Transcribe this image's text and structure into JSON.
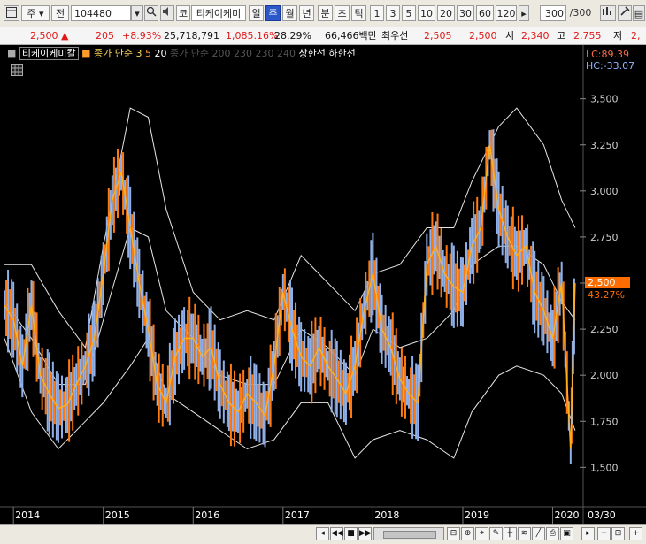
{
  "toolbar": {
    "market": "주",
    "market_dd": "전",
    "code": "104480",
    "tab_code_label": "코",
    "stock_name": "티케이케미",
    "periods": [
      "일",
      "주",
      "월",
      "년",
      "분",
      "초",
      "틱"
    ],
    "active_period": "주",
    "intervals": [
      "1",
      "3",
      "5",
      "10",
      "20",
      "30",
      "60",
      "120"
    ],
    "count": "300",
    "count_total": "/300"
  },
  "quote": {
    "price": "2,500",
    "change_arrow": "▲",
    "change": "205",
    "change_pct": "+8.93%",
    "volume": "25,718,791",
    "vol_ratio": "1,085.16%",
    "turnover": "28.29%",
    "amount": "66,466백만",
    "prior_label": "최우선",
    "ask": "2,505",
    "bid": "2,500",
    "open_label": "시",
    "open": "2,340",
    "high_label": "고",
    "high": "2,755",
    "low_label": "저",
    "low_partial": "2,"
  },
  "legend": {
    "name": "티케이케미칼",
    "ma_label": "종가 단순",
    "ma_periods": [
      "3",
      "5",
      "20"
    ],
    "ma_long": "종가 단순 200 230 230 240",
    "upper_limit": "상한선",
    "lower_limit": "하한선",
    "lc": "LC:89.39",
    "hc": "HC:-33.07"
  },
  "current_price_tag": "2,500",
  "current_pct_tag": "43.27%",
  "end_label": "03/30",
  "chart_data": {
    "type": "line",
    "title": "티케이케미칼",
    "y_ticks": [
      "3,500",
      "3,250",
      "3,000",
      "2,750",
      "2,500",
      "2,250",
      "2,000",
      "1,750",
      "1,500"
    ],
    "ylim": [
      1300,
      3700
    ],
    "x_labels": [
      "2014",
      "2015",
      "2016",
      "2017",
      "2018",
      "2019",
      "2020"
    ],
    "series": [
      {
        "name": "종가",
        "color": "#ff8c1a",
        "x": [
          2013.9,
          2014.0,
          2014.1,
          2014.2,
          2014.3,
          2014.4,
          2014.5,
          2014.6,
          2014.7,
          2014.8,
          2014.9,
          2015.0,
          2015.1,
          2015.2,
          2015.3,
          2015.4,
          2015.5,
          2015.6,
          2015.7,
          2015.8,
          2015.9,
          2016.0,
          2016.1,
          2016.2,
          2016.3,
          2016.4,
          2016.5,
          2016.6,
          2016.7,
          2016.8,
          2016.9,
          2017.0,
          2017.1,
          2017.2,
          2017.3,
          2017.4,
          2017.5,
          2017.6,
          2017.7,
          2017.8,
          2017.9,
          2018.0,
          2018.1,
          2018.2,
          2018.3,
          2018.4,
          2018.5,
          2018.6,
          2018.7,
          2018.8,
          2018.9,
          2019.0,
          2019.1,
          2019.2,
          2019.3,
          2019.4,
          2019.5,
          2019.6,
          2019.7,
          2019.8,
          2019.9,
          2020.0,
          2020.1,
          2020.2,
          2020.25
        ],
        "values": [
          2380,
          2300,
          2050,
          2380,
          2000,
          1900,
          1820,
          1840,
          1950,
          2050,
          2200,
          2550,
          2950,
          3100,
          2800,
          2500,
          2250,
          1950,
          1850,
          2100,
          2200,
          2200,
          2100,
          2150,
          1950,
          1850,
          1800,
          1900,
          1850,
          1780,
          2050,
          2450,
          2250,
          2100,
          2050,
          2150,
          2050,
          1980,
          1900,
          2050,
          2350,
          2550,
          2250,
          2150,
          1980,
          1900,
          1850,
          2600,
          2700,
          2550,
          2480,
          2450,
          2700,
          2800,
          3250,
          2900,
          2750,
          2650,
          2700,
          2450,
          2350,
          2200,
          2500,
          1600,
          2500
        ]
      },
      {
        "name": "20",
        "color": "#ffffff",
        "x": [
          2013.9,
          2014.2,
          2014.5,
          2014.8,
          2015.0,
          2015.3,
          2015.5,
          2015.7,
          2016.0,
          2016.3,
          2016.6,
          2016.9,
          2017.2,
          2017.5,
          2017.8,
          2018.0,
          2018.3,
          2018.6,
          2018.9,
          2019.1,
          2019.4,
          2019.6,
          2019.9,
          2020.1,
          2020.25
        ],
        "values": [
          2400,
          2200,
          1950,
          1950,
          2300,
          2800,
          2750,
          2350,
          2200,
          2000,
          1950,
          1950,
          2250,
          2150,
          2000,
          2250,
          2150,
          2200,
          2350,
          2600,
          2700,
          2700,
          2600,
          2400,
          2300
        ]
      },
      {
        "name": "상한선",
        "color": "#ffffff",
        "x": [
          2013.9,
          2014.2,
          2014.5,
          2014.8,
          2015.0,
          2015.3,
          2015.5,
          2015.7,
          2016.0,
          2016.3,
          2016.6,
          2016.9,
          2017.2,
          2017.5,
          2017.8,
          2018.0,
          2018.3,
          2018.6,
          2018.9,
          2019.1,
          2019.4,
          2019.6,
          2019.9,
          2020.1,
          2020.25
        ],
        "values": [
          2600,
          2600,
          2350,
          2150,
          2700,
          3450,
          3400,
          2900,
          2450,
          2300,
          2350,
          2300,
          2650,
          2500,
          2350,
          2550,
          2600,
          2800,
          2800,
          3050,
          3350,
          3450,
          3250,
          2950,
          2800
        ]
      },
      {
        "name": "하한선",
        "color": "#ffffff",
        "x": [
          2013.9,
          2014.2,
          2014.5,
          2014.8,
          2015.0,
          2015.3,
          2015.5,
          2015.7,
          2016.0,
          2016.3,
          2016.6,
          2016.9,
          2017.2,
          2017.5,
          2017.8,
          2018.0,
          2018.3,
          2018.6,
          2018.9,
          2019.1,
          2019.4,
          2019.6,
          2019.9,
          2020.1,
          2020.25
        ],
        "values": [
          2200,
          1800,
          1600,
          1750,
          1850,
          2050,
          2200,
          1900,
          1800,
          1700,
          1600,
          1650,
          1850,
          1850,
          1550,
          1650,
          1700,
          1650,
          1550,
          1800,
          2000,
          2050,
          2000,
          1900,
          1700
        ]
      }
    ]
  }
}
